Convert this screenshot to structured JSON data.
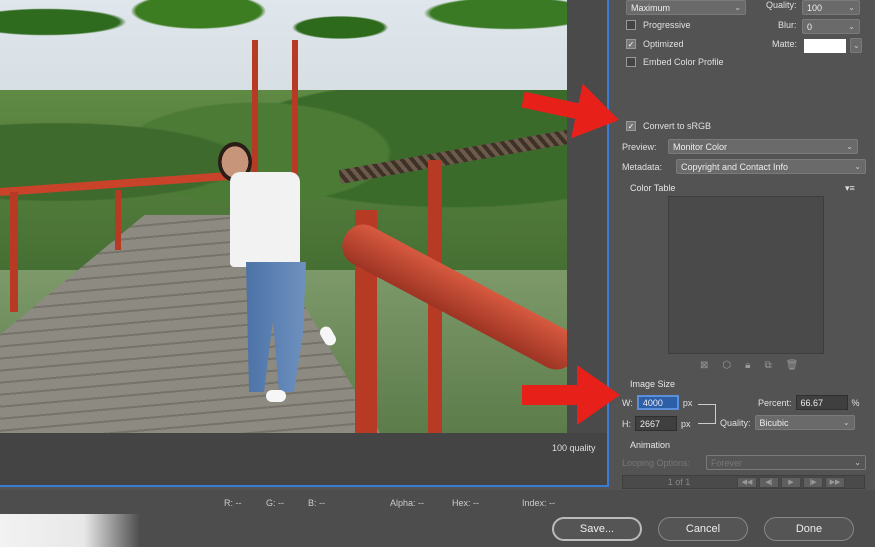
{
  "format": {
    "compression": "Maximum",
    "quality_label": "Quality:",
    "quality_value": "100",
    "blur_label": "Blur:",
    "blur_value": "0",
    "matte_label": "Matte:"
  },
  "options": {
    "progressive": {
      "label": "Progressive",
      "checked": false
    },
    "optimized": {
      "label": "Optimized",
      "checked": true
    },
    "embed_color_profile": {
      "label": "Embed Color Profile",
      "checked": false
    },
    "convert_srgb": {
      "label": "Convert to sRGB",
      "checked": true
    }
  },
  "preview": {
    "label": "Preview:",
    "value": "Monitor Color"
  },
  "metadata": {
    "label": "Metadata:",
    "value": "Copyright and Contact Info"
  },
  "color_table": {
    "title": "Color Table",
    "menu_icon": "▾≡"
  },
  "image_size": {
    "title": "Image Size",
    "w_label": "W:",
    "w_value": "4000",
    "w_unit": "px",
    "h_label": "H:",
    "h_value": "2667",
    "h_unit": "px",
    "percent_label": "Percent:",
    "percent_value": "66.67",
    "percent_unit": "%",
    "quality_label": "Quality:",
    "quality_value": "Bicubic"
  },
  "animation": {
    "title": "Animation",
    "looping_label": "Looping Options:",
    "looping_value": "Forever",
    "frame_counter": "1 of 1"
  },
  "preview_status": "100 quality",
  "status_bar": {
    "r": "R: --",
    "g": "G: --",
    "b": "B: --",
    "alpha": "Alpha: --",
    "hex": "Hex: --",
    "index": "Index: --"
  },
  "buttons": {
    "save": "Save...",
    "cancel": "Cancel",
    "done": "Done"
  },
  "colors": {
    "accent": "#3a7bd5",
    "arrow": "#e8201a",
    "panel_bg": "#535353"
  }
}
